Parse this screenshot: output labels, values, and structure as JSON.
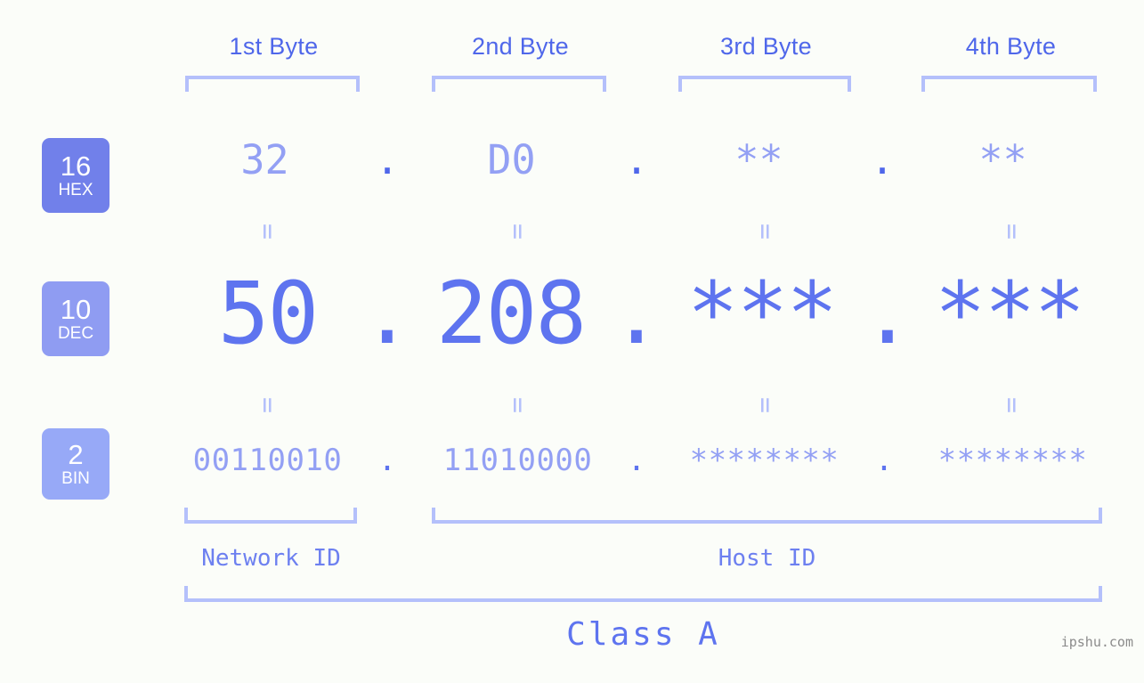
{
  "theme": {
    "background": "#fbfdf9",
    "accent_strong": "#4f67ea",
    "accent_mid": "#5e74ef",
    "accent_light": "#93a0f4",
    "bracket": "#b4c0fb",
    "badge_hex_bg": "#7180ea",
    "badge_dec_bg": "#8f9cf2",
    "badge_bin_bg": "#97a9f7",
    "watermark_color": "#8b8b8b"
  },
  "header": {
    "byte_labels": [
      "1st Byte",
      "2nd Byte",
      "3rd Byte",
      "4th Byte"
    ]
  },
  "badges": [
    {
      "base": "16",
      "name": "HEX"
    },
    {
      "base": "10",
      "name": "DEC"
    },
    {
      "base": "2",
      "name": "BIN"
    }
  ],
  "rows": {
    "hex": {
      "label": "HEX",
      "base": "16",
      "values": [
        "32",
        "D0",
        "**",
        "**"
      ],
      "separators": [
        ".",
        ".",
        "."
      ]
    },
    "dec": {
      "label": "DEC",
      "base": "10",
      "values": [
        "50",
        "208",
        "***",
        "***"
      ],
      "separators": [
        ".",
        ".",
        "."
      ]
    },
    "bin": {
      "label": "BIN",
      "base": "2",
      "values": [
        "00110010",
        "11010000",
        "********",
        "********"
      ],
      "separators": [
        ".",
        ".",
        "."
      ]
    }
  },
  "equivalence_mark": "=",
  "footer": {
    "network_id_label": "Network ID",
    "host_id_label": "Host ID",
    "class_label": "Class A"
  },
  "watermark": "ipshu.com"
}
